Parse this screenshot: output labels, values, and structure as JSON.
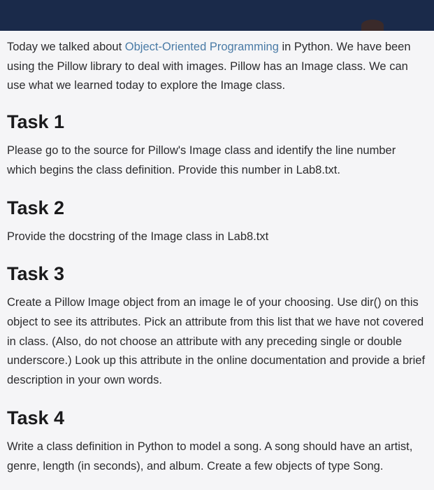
{
  "intro": {
    "prefix": "Today we talked about ",
    "link_text": "Object-Oriented Programming",
    "suffix": " in Python. We have been using the Pillow library to deal with images. Pillow has an Image class. We can use what we learned today to explore the Image class."
  },
  "tasks": [
    {
      "heading": "Task 1",
      "body": "Please go to the source for Pillow's Image class and identify the line number which begins the class definition. Provide this number in Lab8.txt."
    },
    {
      "heading": "Task 2",
      "body": "Provide the docstring of the Image class in Lab8.txt"
    },
    {
      "heading": "Task 3",
      "body": "Create a Pillow Image object from an image le of your choosing. Use dir() on this object to see its attributes. Pick an attribute from this list that we have not covered in class. (Also, do not choose an attribute with any preceding single or double underscore.) Look up this attribute in the online documentation and provide a brief description in your own words."
    },
    {
      "heading": "Task 4",
      "body": "Write a class definition in Python to model a song. A song should have an artist, genre, length (in seconds), and album. Create a few objects of type Song."
    }
  ]
}
